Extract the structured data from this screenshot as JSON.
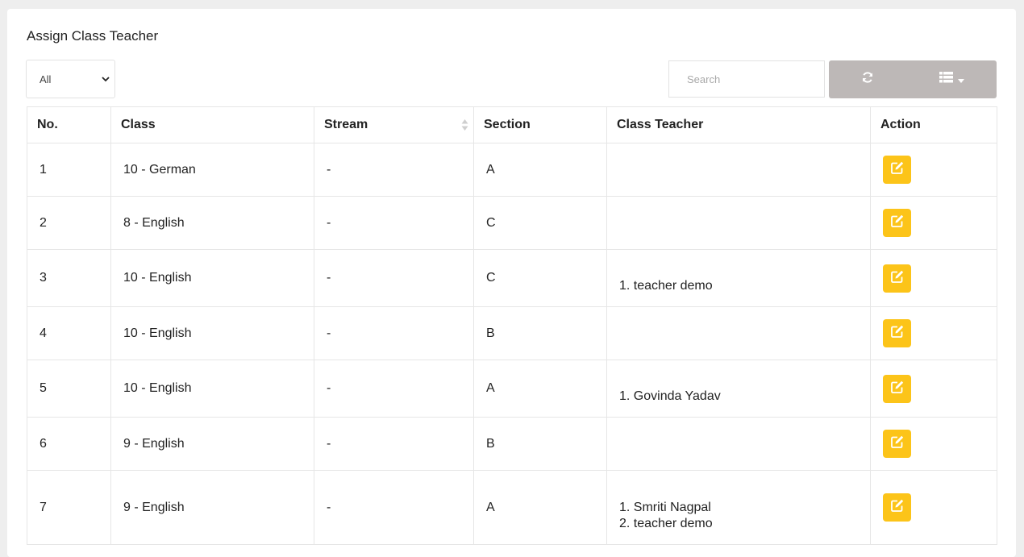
{
  "page": {
    "title": "Assign Class Teacher"
  },
  "filter": {
    "selected": "All"
  },
  "search": {
    "placeholder": "Search"
  },
  "table": {
    "columns": {
      "no": "No.",
      "class": "Class",
      "stream": "Stream",
      "section": "Section",
      "teacher": "Class Teacher",
      "action": "Action"
    },
    "rows": [
      {
        "no": "1",
        "class": "10 - German",
        "stream": "-",
        "section": "A",
        "teachers": []
      },
      {
        "no": "2",
        "class": "8 - English",
        "stream": "-",
        "section": "C",
        "teachers": []
      },
      {
        "no": "3",
        "class": "10 - English",
        "stream": "-",
        "section": "C",
        "teachers": [
          "1. teacher demo"
        ]
      },
      {
        "no": "4",
        "class": "10 - English",
        "stream": "-",
        "section": "B",
        "teachers": []
      },
      {
        "no": "5",
        "class": "10 - English",
        "stream": "-",
        "section": "A",
        "teachers": [
          "1. Govinda Yadav"
        ]
      },
      {
        "no": "6",
        "class": "9 - English",
        "stream": "-",
        "section": "B",
        "teachers": []
      },
      {
        "no": "7",
        "class": "9 - English",
        "stream": "-",
        "section": "A",
        "teachers": [
          "1. Smriti Nagpal",
          "2. teacher demo"
        ]
      }
    ]
  },
  "icons": {
    "refresh": "refresh-icon",
    "columns": "columns-icon",
    "edit": "edit-icon",
    "sort": "sort-icon",
    "chevron": "chevron-down-icon"
  },
  "colors": {
    "edit_button": "#fcc419",
    "toolbar_button": "#bdb8b7",
    "background": "#eeeeee"
  }
}
